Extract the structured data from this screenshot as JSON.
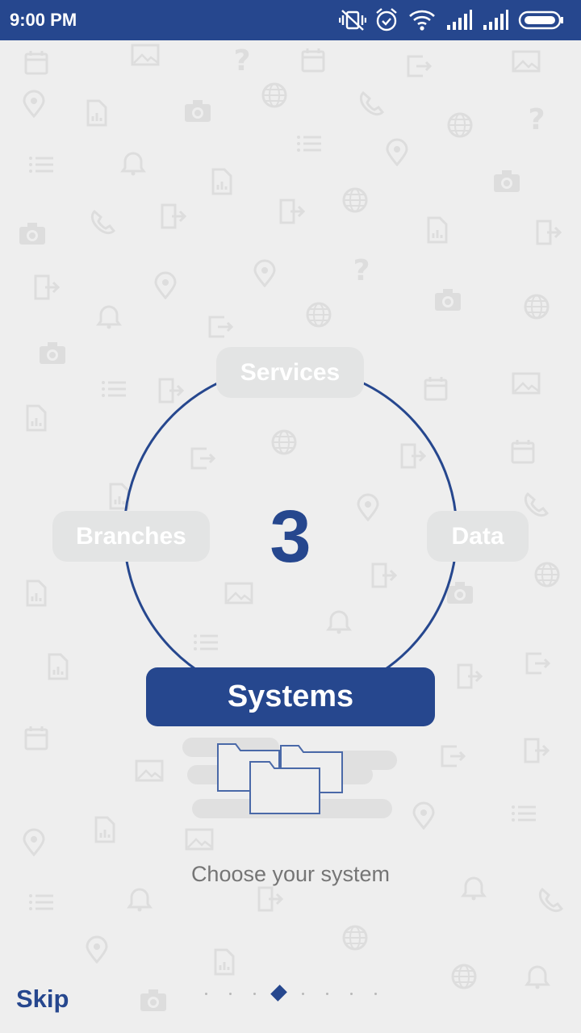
{
  "status_bar": {
    "time": "9:00 PM",
    "icons": [
      "vibrate-off-icon",
      "alarm-icon",
      "wifi-icon",
      "signal-icon",
      "signal-icon",
      "battery-icon"
    ]
  },
  "diagram": {
    "number": "3",
    "top_label": "Services",
    "left_label": "Branches",
    "right_label": "Data",
    "highlight_label": "Systems"
  },
  "illustration": {
    "icon": "folders-icon"
  },
  "subtitle": "Choose your system",
  "footer": {
    "skip_label": "Skip",
    "page_indicator": {
      "total": 8,
      "current": 4
    }
  },
  "colors": {
    "primary": "#26478e",
    "background": "#eeeeee",
    "pill": "#e3e4e4",
    "pattern": "#e0e0e0"
  }
}
